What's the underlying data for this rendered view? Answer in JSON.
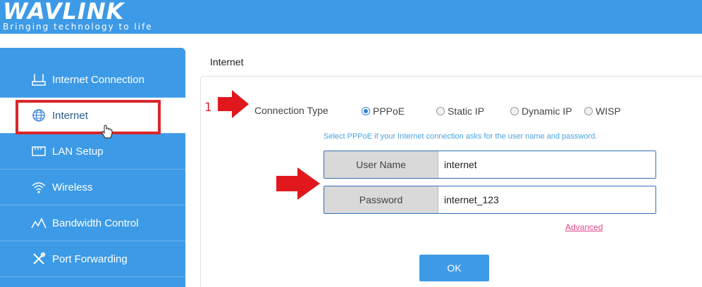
{
  "brand": {
    "logo_text": "WAVLINK",
    "tagline": "Bringing technology to life"
  },
  "sidebar": {
    "items": [
      {
        "label": "Internet Connection",
        "icon": "router-icon"
      },
      {
        "label": "Internet",
        "icon": "globe-icon",
        "active": true
      },
      {
        "label": "LAN Setup",
        "icon": "lan-icon"
      },
      {
        "label": "Wireless",
        "icon": "wifi-icon"
      },
      {
        "label": "Bandwidth Control",
        "icon": "bandwidth-icon"
      },
      {
        "label": "Port Forwarding",
        "icon": "tools-icon"
      }
    ]
  },
  "main": {
    "title": "Internet",
    "step_number": "1",
    "connection_type_label": "Connection Type",
    "connection_types": [
      "PPPoE",
      "Static IP",
      "Dynamic IP",
      "WISP"
    ],
    "selected_connection_type": "PPPoE",
    "hint": "Select PPPoE if your Internet connection asks for the user name and password.",
    "username_label": "User Name",
    "username_value": "internet",
    "password_label": "Password",
    "password_value": "internet_123",
    "advanced_link": "Advanced",
    "ok_button": "OK"
  },
  "colors": {
    "primary": "#3d9ae6",
    "annotation_red": "#d9262c",
    "hint_blue": "#4aa3df",
    "link_pink": "#e0448a"
  }
}
